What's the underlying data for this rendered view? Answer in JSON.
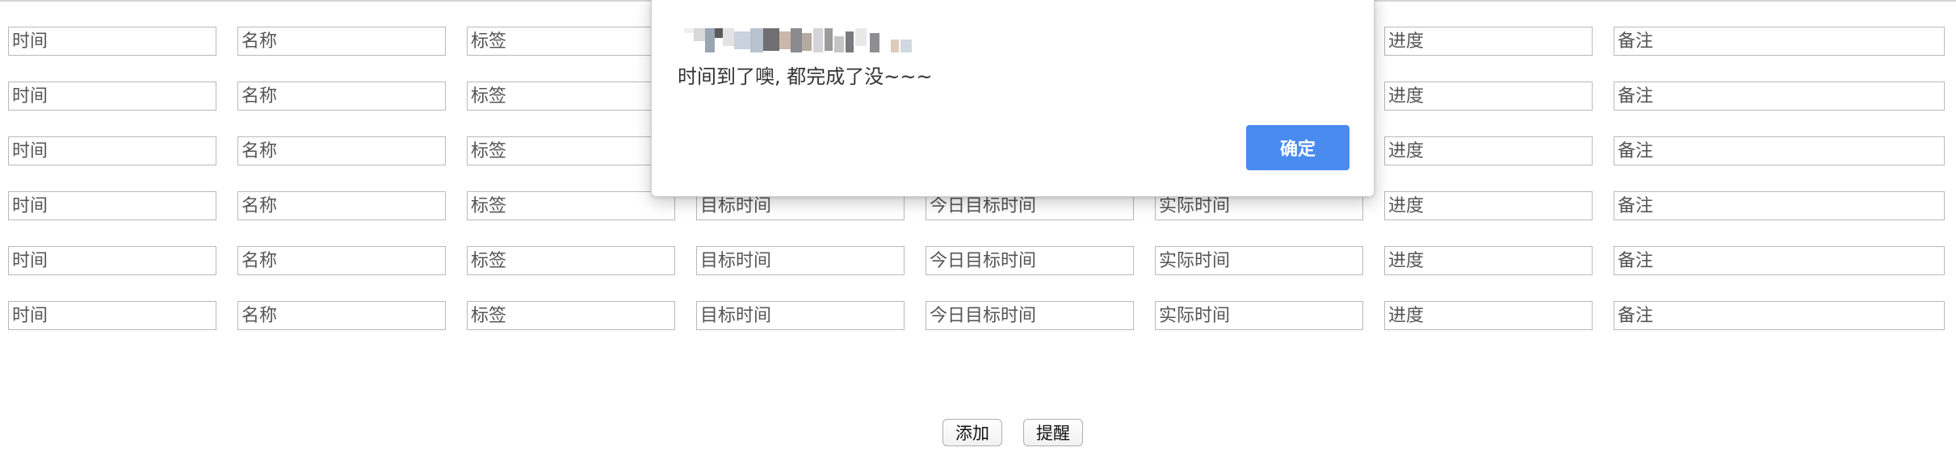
{
  "form": {
    "row_count": 6,
    "fields": [
      {
        "key": "time",
        "placeholder": "时间"
      },
      {
        "key": "name",
        "placeholder": "名称"
      },
      {
        "key": "tag",
        "placeholder": "标签"
      },
      {
        "key": "target_time",
        "placeholder": "目标时间"
      },
      {
        "key": "today_target_time",
        "placeholder": "今日目标时间"
      },
      {
        "key": "actual_time",
        "placeholder": "实际时间"
      },
      {
        "key": "progress",
        "placeholder": "进度"
      },
      {
        "key": "remark",
        "placeholder": "备注"
      }
    ]
  },
  "actions": {
    "add_label": "添加",
    "remind_label": "提醒"
  },
  "alert": {
    "message": "时间到了噢, 都完成了没~~~",
    "ok_label": "确定"
  },
  "colors": {
    "accent": "#4a8bef",
    "input_border": "#b9b9b9",
    "placeholder_text": "#555555"
  }
}
